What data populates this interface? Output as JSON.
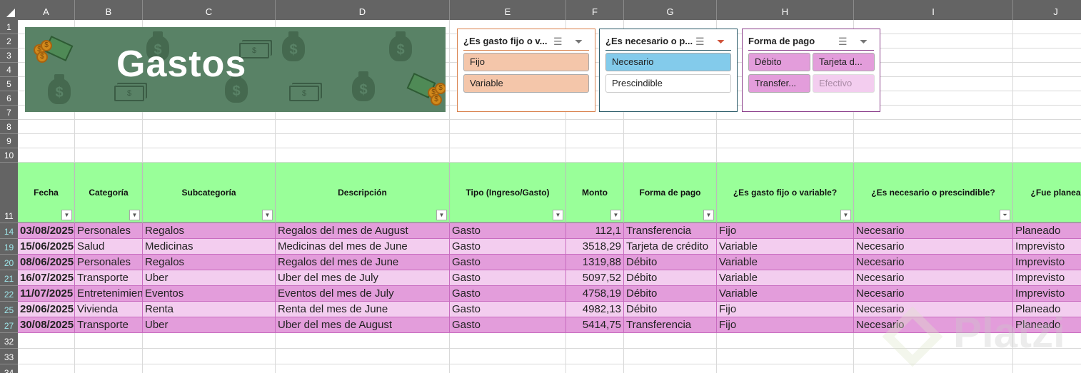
{
  "columns": [
    "A",
    "B",
    "C",
    "D",
    "E",
    "F",
    "G",
    "H",
    "I",
    "J"
  ],
  "banner": {
    "title": "Gastos"
  },
  "slicers": [
    {
      "title": "¿Es gasto fijo o v...",
      "border": "#d9804a",
      "items": [
        {
          "label": "Fijo",
          "state": "selected"
        },
        {
          "label": "Variable",
          "state": "selected"
        }
      ],
      "sel_color": "#f4c6aa"
    },
    {
      "title": "¿Es necesario o p...",
      "border": "#2a5a68",
      "items": [
        {
          "label": "Necesario",
          "state": "selected"
        },
        {
          "label": "Prescindible",
          "state": "unselected"
        }
      ],
      "sel_color": "#83cbeb"
    },
    {
      "title": "Forma de pago",
      "border": "#8a3d8a",
      "items": [
        {
          "label": "Débito",
          "state": "selected"
        },
        {
          "label": "Tarjeta d...",
          "state": "selected"
        },
        {
          "label": "Transfer...",
          "state": "selected"
        },
        {
          "label": "Efectivo",
          "state": "nodata"
        }
      ],
      "sel_color": "#e39ddb"
    }
  ],
  "slicer_icons": {
    "multi": "multi-select-icon",
    "clear": "clear-filter-icon"
  },
  "table": {
    "headers": [
      "Fecha",
      "Categoría",
      "Subcategoría",
      "Descripción",
      "Tipo (Ingreso/Gasto)",
      "Monto",
      "Forma de pago",
      "¿Es gasto fijo o variable?",
      "¿Es necesario o prescindible?",
      "¿Fue planea"
    ],
    "filtered_column": 8,
    "rows": [
      {
        "n": "14",
        "cells": [
          "03/08/2025",
          "Personales",
          "Regalos",
          "Regalos del mes de August",
          "Gasto",
          "112,1",
          "Transferencia",
          "Fijo",
          "Necesario",
          "Planeado"
        ]
      },
      {
        "n": "19",
        "cells": [
          "15/06/2025",
          "Salud",
          "Medicinas",
          "Medicinas del mes de June",
          "Gasto",
          "3518,29",
          "Tarjeta de crédito",
          "Variable",
          "Necesario",
          "Imprevisto"
        ]
      },
      {
        "n": "20",
        "cells": [
          "08/06/2025",
          "Personales",
          "Regalos",
          "Regalos del mes de June",
          "Gasto",
          "1319,88",
          "Débito",
          "Variable",
          "Necesario",
          "Imprevisto"
        ]
      },
      {
        "n": "21",
        "cells": [
          "16/07/2025",
          "Transporte",
          "Uber",
          "Uber del mes de July",
          "Gasto",
          "5097,52",
          "Débito",
          "Variable",
          "Necesario",
          "Imprevisto"
        ]
      },
      {
        "n": "22",
        "cells": [
          "11/07/2025",
          "Entretenimiento",
          "Eventos",
          "Eventos del mes de July",
          "Gasto",
          "4758,19",
          "Débito",
          "Variable",
          "Necesario",
          "Imprevisto"
        ]
      },
      {
        "n": "25",
        "cells": [
          "29/06/2025",
          "Vivienda",
          "Renta",
          "Renta del mes de June",
          "Gasto",
          "4982,13",
          "Débito",
          "Fijo",
          "Necesario",
          "Planeado"
        ]
      },
      {
        "n": "27",
        "cells": [
          "30/08/2025",
          "Transporte",
          "Uber",
          "Uber del mes de August",
          "Gasto",
          "5414,75",
          "Transferencia",
          "Fijo",
          "Necesario",
          "Planeado"
        ]
      }
    ]
  },
  "blank_rows_top": [
    "1",
    "2",
    "3",
    "4",
    "5",
    "6",
    "7",
    "8",
    "9",
    "10"
  ],
  "header_row": "11",
  "blank_rows_bottom": [
    "32",
    "33",
    "34"
  ],
  "watermark": "Platzi"
}
